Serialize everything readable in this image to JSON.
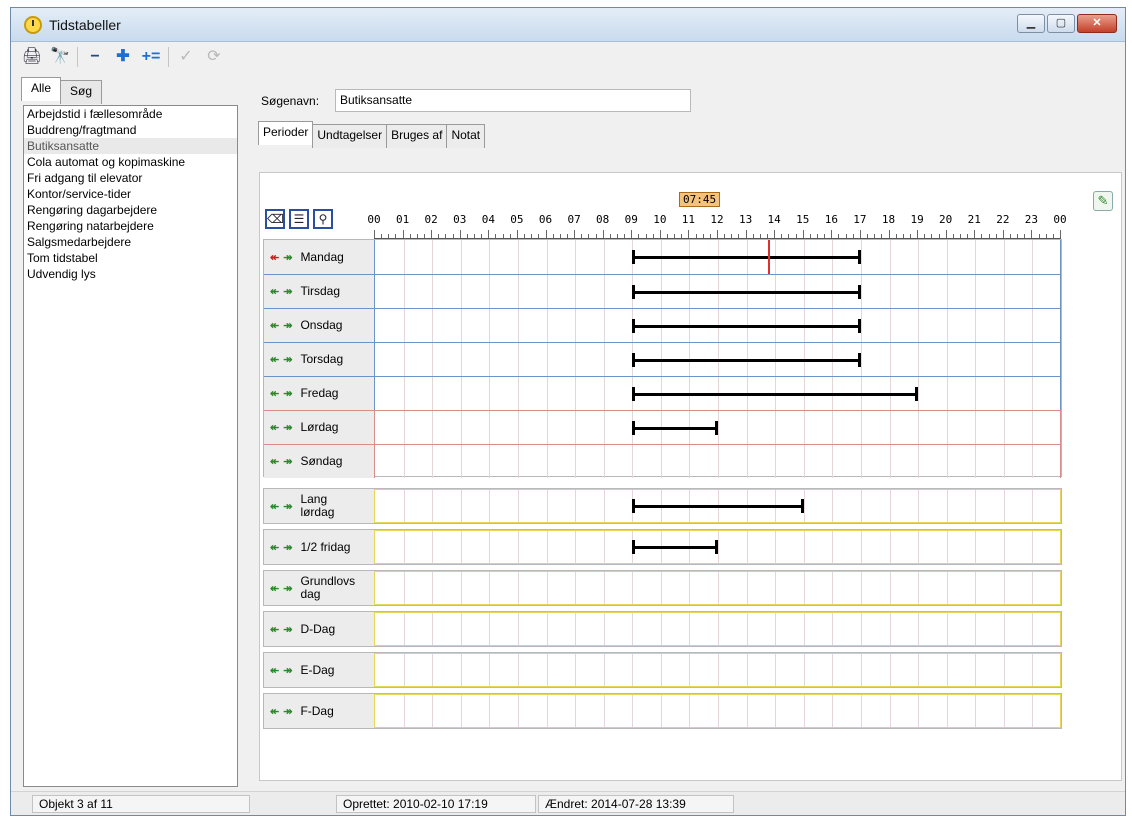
{
  "window": {
    "title": "Tidstabeller"
  },
  "left": {
    "tabs": [
      "Alle",
      "Søg"
    ],
    "items": [
      "Arbejdstid i fællesområde",
      "Buddreng/fragtmand",
      "Butiksansatte",
      "Cola automat og kopimaskine",
      "Fri adgang til elevator",
      "Kontor/service-tider",
      "Rengøring dagarbejdere",
      "Rengøring natarbejdere",
      "Salgsmedarbejdere",
      "Tom tidstabel",
      "Udvendig lys"
    ],
    "selected_index": 2
  },
  "search": {
    "label": "Søgenavn:",
    "value": "Butiksansatte"
  },
  "tabs": [
    "Perioder",
    "Undtagelser",
    "Bruges af",
    "Notat"
  ],
  "schedule": {
    "now_label": "07:45",
    "now_hour": 13.75,
    "hour_labels": [
      "00",
      "01",
      "02",
      "03",
      "04",
      "05",
      "06",
      "07",
      "08",
      "09",
      "10",
      "11",
      "12",
      "13",
      "14",
      "15",
      "16",
      "17",
      "18",
      "19",
      "20",
      "21",
      "22",
      "23",
      "00"
    ],
    "weekdays": [
      {
        "label": "Mandag",
        "start": 9,
        "end": 17,
        "type": "weekday",
        "back_red": true
      },
      {
        "label": "Tirsdag",
        "start": 9,
        "end": 17,
        "type": "weekday"
      },
      {
        "label": "Onsdag",
        "start": 9,
        "end": 17,
        "type": "weekday"
      },
      {
        "label": "Torsdag",
        "start": 9,
        "end": 17,
        "type": "weekday"
      },
      {
        "label": "Fredag",
        "start": 9,
        "end": 19,
        "type": "weekday"
      },
      {
        "label": "Lørdag",
        "start": 9,
        "end": 12,
        "type": "weekend"
      },
      {
        "label": "Søndag",
        "start": null,
        "end": null,
        "type": "weekend"
      }
    ],
    "special_days": [
      {
        "label": "Lang lørdag",
        "start": 9,
        "end": 15
      },
      {
        "label": "1/2 fridag",
        "start": 9,
        "end": 12
      },
      {
        "label": "Grundlovs dag",
        "start": null,
        "end": null
      },
      {
        "label": "D-Dag",
        "start": null,
        "end": null
      },
      {
        "label": "E-Dag",
        "start": null,
        "end": null
      },
      {
        "label": "F-Dag",
        "start": null,
        "end": null
      }
    ],
    "colors": {
      "weekday_border": "#6b94c9",
      "weekend_border": "#d98c8c",
      "special_border": "#e6d65a"
    }
  },
  "status": {
    "object": "Objekt 3 af 11",
    "created": "Oprettet: 2010-02-10  17:19",
    "changed": "Ændret: 2014-07-28  13:39"
  },
  "icons": [
    "app-clock-icon",
    "print-icon",
    "find-icon",
    "remove-icon",
    "add-icon",
    "add-multiple-icon",
    "confirm-icon",
    "refresh-icon",
    "eraser-icon",
    "split-icon",
    "zoom-icon",
    "edit-icon"
  ]
}
